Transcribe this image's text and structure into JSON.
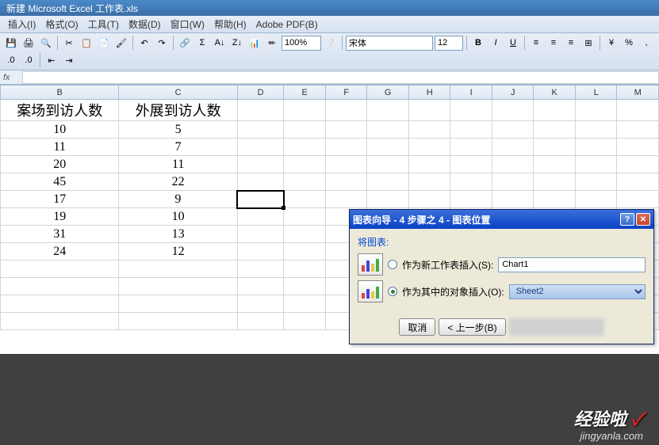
{
  "title": "新建 Microsoft Excel 工作表.xls",
  "menu": [
    "插入(I)",
    "格式(O)",
    "工具(T)",
    "数据(D)",
    "窗口(W)",
    "帮助(H)",
    "Adobe PDF(B)"
  ],
  "toolbar": {
    "zoom": "100%",
    "font_name": "宋体",
    "font_size": "12",
    "bold": "B",
    "italic": "I",
    "underline": "U"
  },
  "formula_bar": {
    "fx": "fx",
    "value": ""
  },
  "columns": [
    "B",
    "C",
    "D",
    "E",
    "F",
    "G",
    "H",
    "I",
    "J",
    "K",
    "L",
    "M"
  ],
  "headers": [
    "案场到访人数",
    "外展到访人数"
  ],
  "rows": [
    [
      "10",
      "5"
    ],
    [
      "11",
      "7"
    ],
    [
      "20",
      "11"
    ],
    [
      "45",
      "22"
    ],
    [
      "17",
      "9"
    ],
    [
      "19",
      "10"
    ],
    [
      "31",
      "13"
    ],
    [
      "24",
      "12"
    ]
  ],
  "dialog": {
    "title": "图表向导 - 4 步骤之 4 - 图表位置",
    "group_label": "将图表:",
    "opt1_label": "作为新工作表插入(S):",
    "opt1_value": "Chart1",
    "opt2_label": "作为其中的对象插入(O):",
    "opt2_value": "Sheet2",
    "btn_cancel": "取消",
    "btn_back": "< 上一步(B)"
  },
  "watermark": {
    "brand": "经验啦",
    "url": "jingyanla.com",
    "check": "✓"
  }
}
